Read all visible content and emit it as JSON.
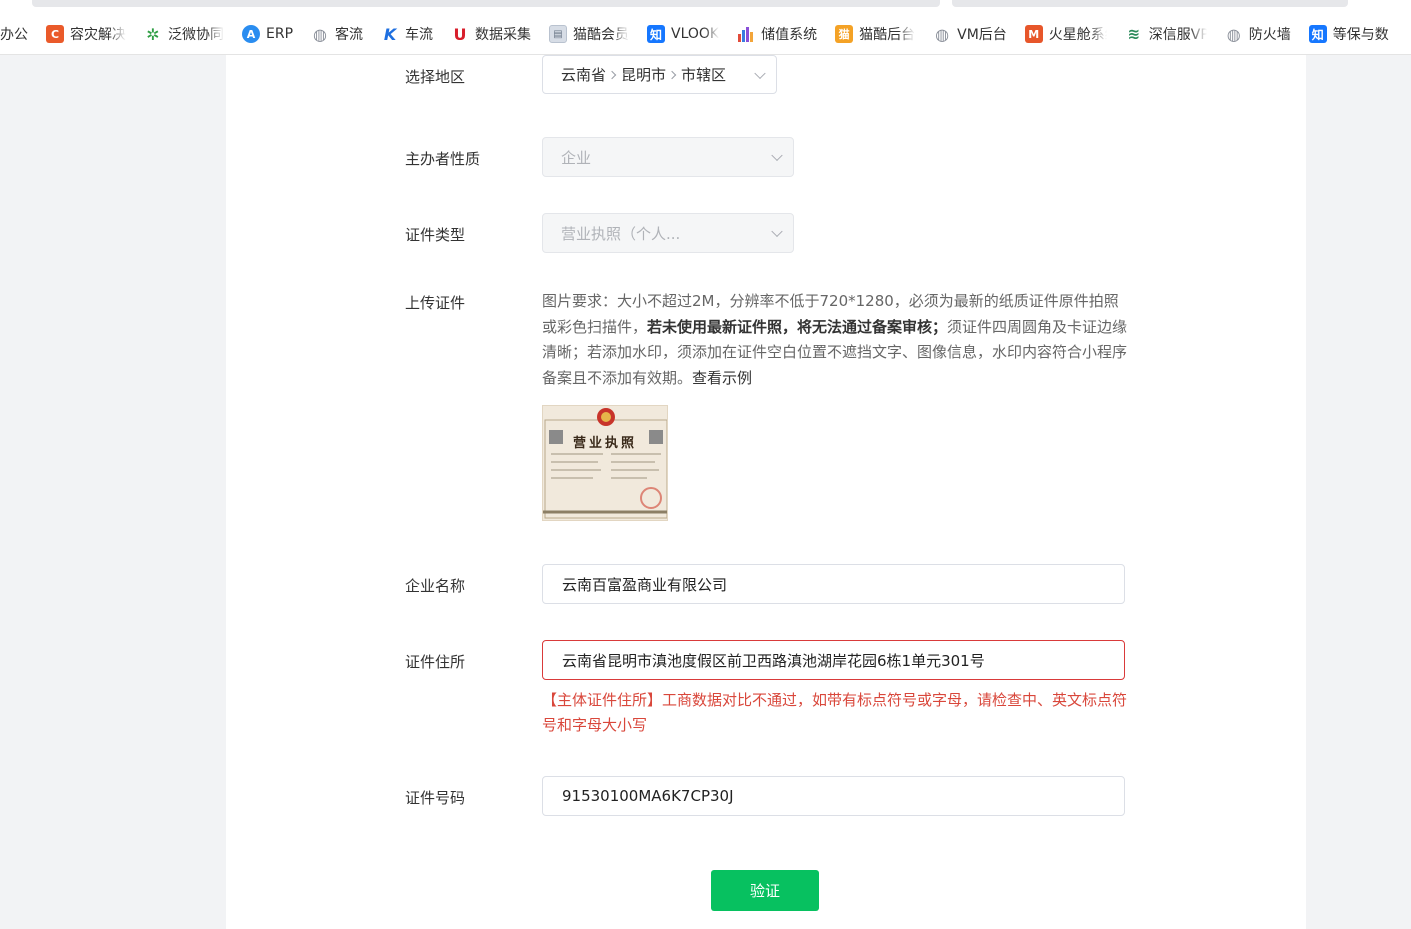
{
  "bookmarks": [
    {
      "label": "办公",
      "icon": "none"
    },
    {
      "label": "容灾解决",
      "icon": "c-letter-icon",
      "glyph": "C",
      "style": "orange",
      "fade": true
    },
    {
      "label": "泛微协同",
      "icon": "flower-icon",
      "glyph": "✲",
      "style": "green",
      "fade": true
    },
    {
      "label": "ERP",
      "icon": "a-circle-icon",
      "glyph": "A",
      "style": "blue-circle"
    },
    {
      "label": "客流",
      "icon": "globe-icon",
      "glyph": "◍",
      "style": "globe"
    },
    {
      "label": "车流",
      "icon": "k-logo-icon",
      "glyph": "K",
      "style": "kblue"
    },
    {
      "label": "数据采集",
      "icon": "u-logo-icon",
      "glyph": "U",
      "style": "ured"
    },
    {
      "label": "猫酷会员",
      "icon": "document-icon",
      "glyph": "▤",
      "style": "doc",
      "fade": true
    },
    {
      "label": "VLOOK",
      "icon": "zhi-icon",
      "glyph": "知",
      "style": "zhi",
      "fade": true
    },
    {
      "label": "储值系统",
      "icon": "bar-chart-icon",
      "glyph": "",
      "style": "bars"
    },
    {
      "label": "猫酷后台",
      "icon": "cat-icon",
      "glyph": "猫",
      "style": "cat",
      "fade": true
    },
    {
      "label": "VM后台",
      "icon": "globe-icon",
      "glyph": "◍",
      "style": "globe"
    },
    {
      "label": "火星舱系统",
      "icon": "mars-icon",
      "glyph": "M",
      "style": "fire",
      "fade": true
    },
    {
      "label": "深信服VPN",
      "icon": "sangfor-icon",
      "glyph": "≋",
      "style": "shen",
      "fade": true
    },
    {
      "label": "防火墙",
      "icon": "globe-icon",
      "glyph": "◍",
      "style": "globe"
    },
    {
      "label": "等保与数",
      "icon": "zhi-icon",
      "glyph": "知",
      "style": "zhi"
    }
  ],
  "form": {
    "region": {
      "label": "选择地区",
      "province": "云南省",
      "city": "昆明市",
      "district": "市辖区"
    },
    "organizer_type": {
      "label": "主办者性质",
      "value": "企业"
    },
    "cert_type": {
      "label": "证件类型",
      "value": "营业执照（个人..."
    },
    "upload": {
      "label": "上传证件",
      "hint_prefix": "图片要求：大小不超过2M，分辨率不低于720*1280，必须为最新的纸质证件原件拍照或彩色扫描件，",
      "hint_bold": "若未使用最新证件照，将无法通过备案审核；",
      "hint_suffix": "须证件四周圆角及卡证边缘清晰；若添加水印，须添加在证件空白位置不遮挡文字、图像信息，水印内容符合小程序备案且不添加有效期。",
      "example_link": "查看示例",
      "license_title": "营业执照"
    },
    "company_name": {
      "label": "企业名称",
      "value": "云南百富盈商业有限公司"
    },
    "cert_address": {
      "label": "证件住所",
      "value": "云南省昆明市滇池度假区前卫西路滇池湖岸花园6栋1单元301号",
      "error": "【主体证件住所】工商数据对比不通过，如带有标点符号或字母，请检查中、英文标点符号和字母大小写"
    },
    "cert_number": {
      "label": "证件号码",
      "value": "91530100MA6K7CP30J"
    },
    "verify_button": "验证"
  },
  "colors": {
    "primary_green": "#07c160",
    "error_red": "#d9473b",
    "error_border": "#d93a3a"
  }
}
